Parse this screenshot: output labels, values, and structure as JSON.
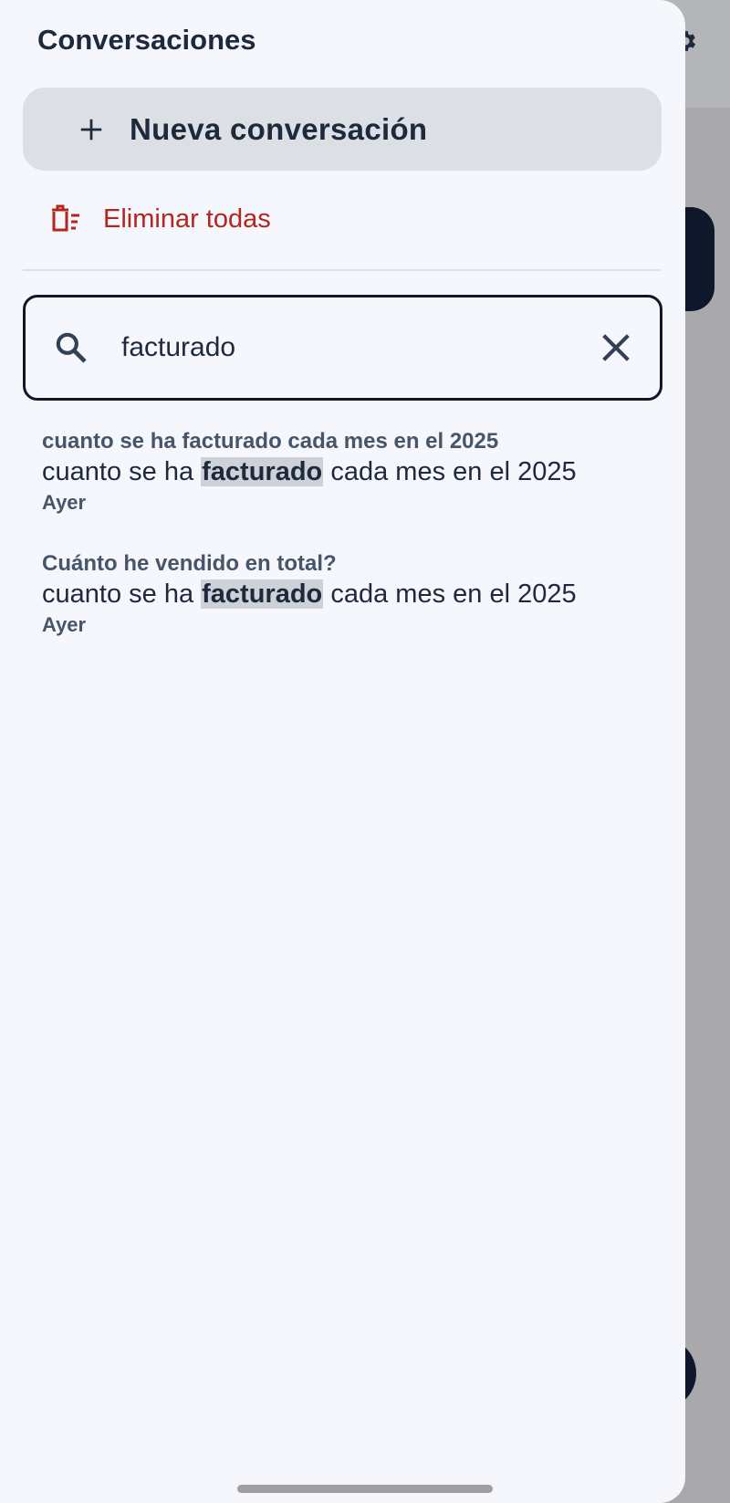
{
  "drawer": {
    "title": "Conversaciones",
    "new_conversation_label": "Nueva conversación",
    "delete_all_label": "Eliminar todas"
  },
  "search": {
    "value": "facturado",
    "placeholder": ""
  },
  "results": [
    {
      "conversation_title": "cuanto se ha facturado cada mes en el 2025",
      "snippet_before": "cuanto se ha ",
      "snippet_match": "facturado",
      "snippet_after": " cada mes en el 2025",
      "date": "Ayer"
    },
    {
      "conversation_title": "Cuánto he vendido en total?",
      "snippet_before": "cuanto se ha ",
      "snippet_match": "facturado",
      "snippet_after": " cada mes en el 2025",
      "date": "Ayer"
    }
  ],
  "icons": {
    "new_conversation": "plus-icon",
    "delete_all": "delete-sweep-icon",
    "search": "search-icon",
    "clear": "close-icon",
    "settings": "gear-icon"
  },
  "colors": {
    "drawer_bg": "#f5f7fc",
    "primary_text": "#1e293b",
    "danger": "#b3261e",
    "highlight": "#cdd1d8",
    "scrim": "#a9a9ab"
  }
}
